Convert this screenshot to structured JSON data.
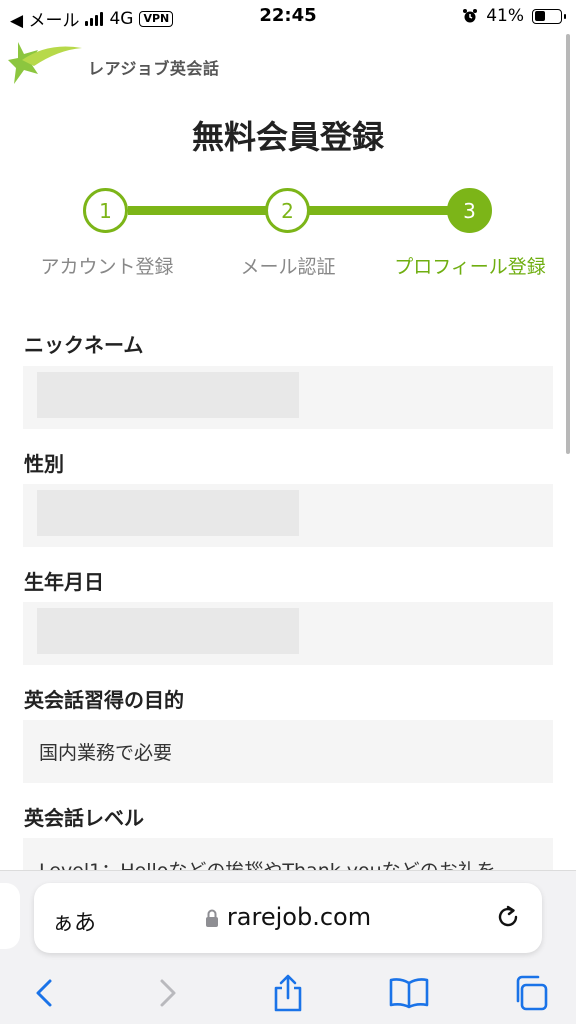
{
  "status_bar": {
    "back_app": "◀ メール",
    "network": "4G",
    "vpn": "VPN",
    "time": "22:45",
    "battery": "41%",
    "battery_level": 0.41
  },
  "header": {
    "logo_text": "レアジョブ英会話",
    "title": "無料会員登録"
  },
  "stepper": {
    "steps": [
      {
        "number": "1",
        "label": "アカウント登録"
      },
      {
        "number": "2",
        "label": "メール認証"
      },
      {
        "number": "3",
        "label": "プロフィール登録"
      }
    ],
    "current_step": 3
  },
  "form": {
    "nickname_label": "ニックネーム",
    "gender_label": "性別",
    "birthday_label": "生年月日",
    "purpose_label": "英会話習得の目的",
    "purpose_value": "国内業務で必要",
    "level_label": "英会話レベル",
    "level_value": "Level1：Helloなどの挨拶やThank youなどのお礼を"
  },
  "browser": {
    "aa_label": "ぁあ",
    "url": "rarejob.com"
  },
  "colors": {
    "accent": "#7cb518",
    "field_bg": "#f5f5f5"
  }
}
